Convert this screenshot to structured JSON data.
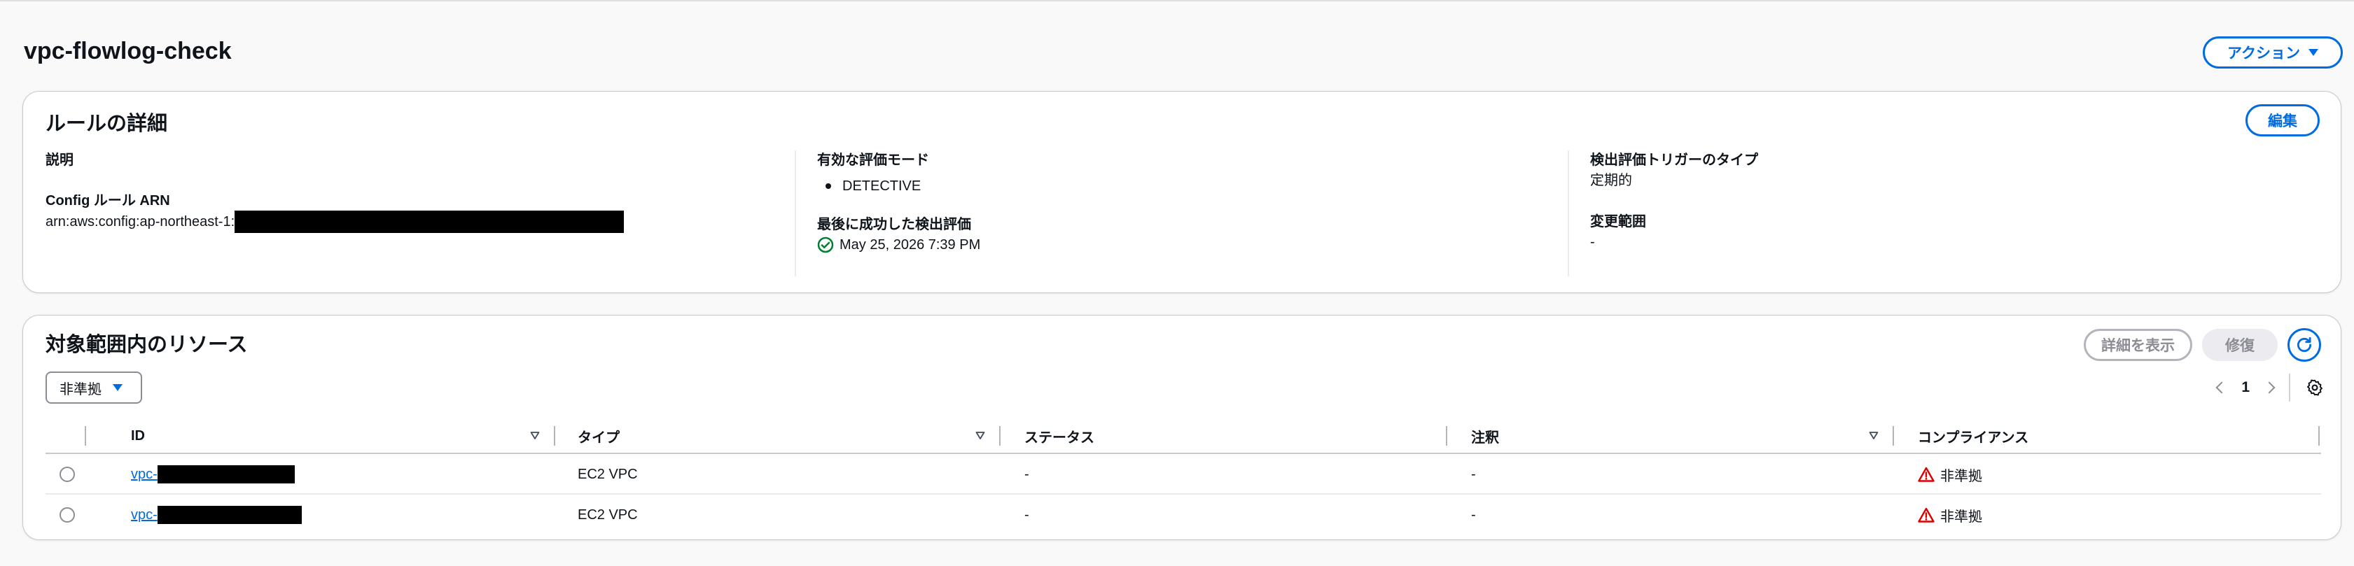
{
  "page": {
    "title": "vpc-flowlog-check",
    "actions_label": "アクション"
  },
  "rule_details": {
    "title": "ルールの詳細",
    "edit_label": "編集",
    "description_label": "説明",
    "description_value": "",
    "arn_label": "Config ルール ARN",
    "arn_prefix": "arn:aws:config:ap-northeast-1:",
    "eval_mode_label": "有効な評価モード",
    "eval_mode_value": "DETECTIVE",
    "last_success_label": "最後に成功した検出評価",
    "last_success_value": "May 25, 2026 7:39 PM",
    "trigger_type_label": "検出評価トリガーのタイプ",
    "trigger_type_value": "定期的",
    "scope_label": "変更範囲",
    "scope_value": "-"
  },
  "resources": {
    "title": "対象範囲内のリソース",
    "view_details_label": "詳細を表示",
    "remediate_label": "修復",
    "filter_value": "非準拠",
    "current_page": "1",
    "columns": {
      "id": "ID",
      "type": "タイプ",
      "status": "ステータス",
      "annotation": "注釈",
      "compliance": "コンプライアンス"
    },
    "rows": [
      {
        "id": "vpc-",
        "type": "EC2 VPC",
        "status": "-",
        "annotation": "-",
        "compliance": "非準拠"
      },
      {
        "id": "vpc-",
        "type": "EC2 VPC",
        "status": "-",
        "annotation": "-",
        "compliance": "非準拠"
      }
    ]
  },
  "colors": {
    "accent": "#006ce0",
    "success": "#00802f",
    "error": "#db0000"
  }
}
